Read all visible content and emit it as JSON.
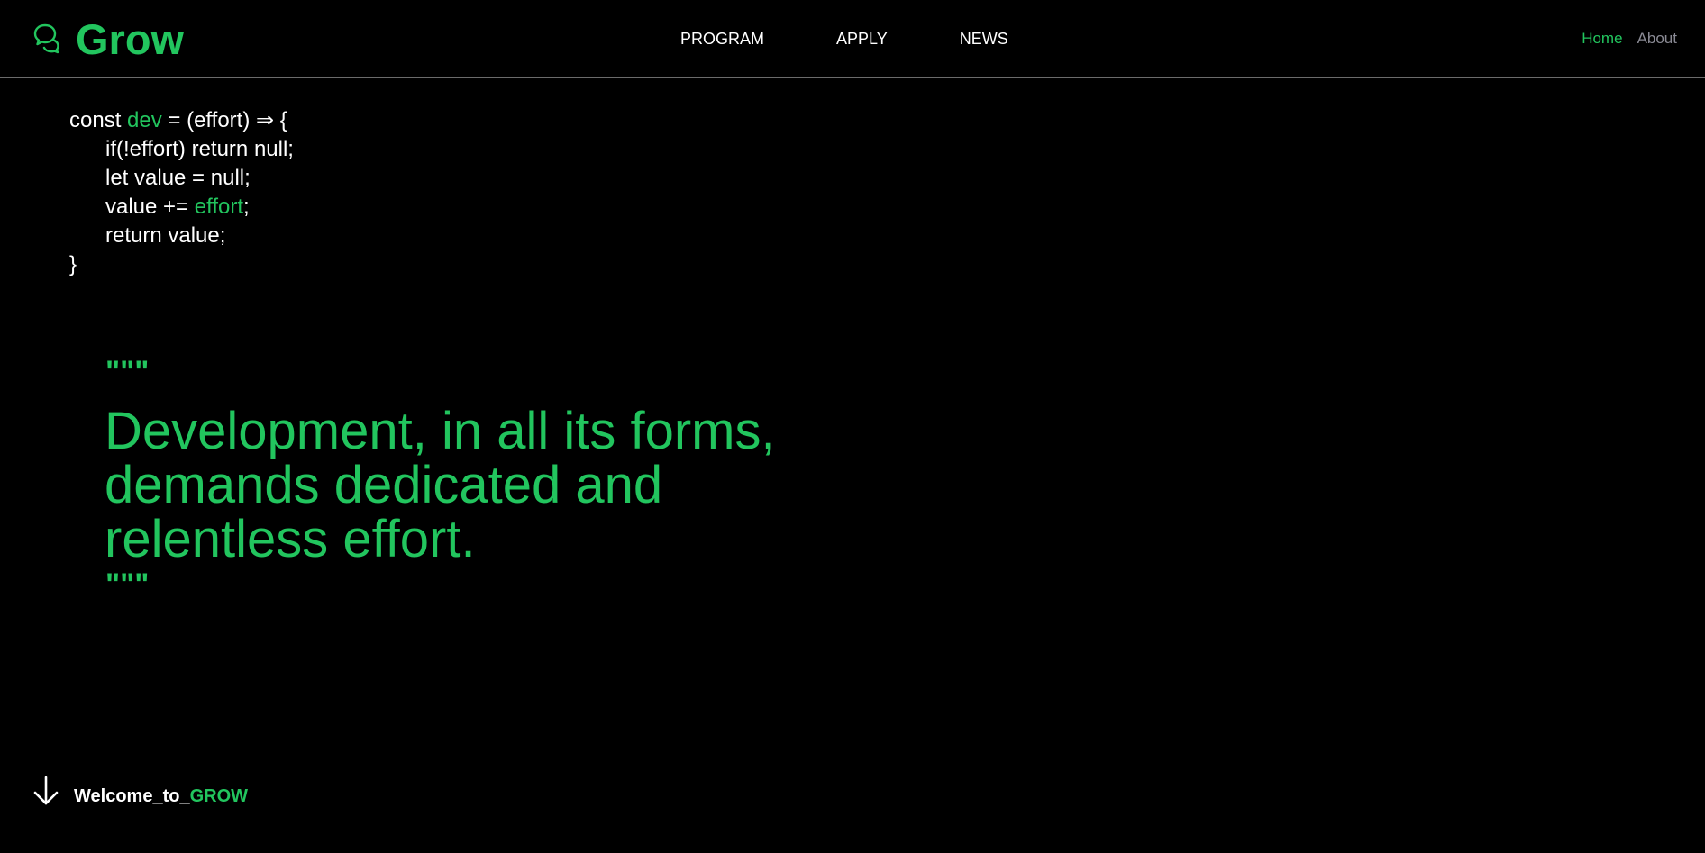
{
  "colors": {
    "background": "#000000",
    "accent": "#22c55e",
    "text": "#ffffff",
    "muted": "#8a8a94",
    "divider": "#6b6b6b"
  },
  "header": {
    "brand_icon": "chat-bubbles-icon",
    "brand_name": "Grow",
    "nav": [
      {
        "label": "PROGRAM"
      },
      {
        "label": "APPLY"
      },
      {
        "label": "NEWS"
      }
    ],
    "right_links": {
      "home": "Home",
      "about": "About"
    }
  },
  "code": {
    "line1_a": "const ",
    "line1_b": "dev",
    "line1_c": " = (effort) ⇒ {",
    "line2": "if(!effort) return null;",
    "line3": "let value = null;",
    "line4_a": "value += ",
    "line4_b": "effort",
    "line4_c": ";",
    "line5": "return value;",
    "line6": "}"
  },
  "quote": {
    "open_marks": "\"\"\"",
    "text": "Development, in all its forms, demands dedicated and relentless effort.",
    "close_marks": "\"\"\""
  },
  "footer": {
    "arrow_icon": "arrow-down-icon",
    "welcome_prefix": "Welcome_to_",
    "welcome_highlight": "GROW"
  }
}
